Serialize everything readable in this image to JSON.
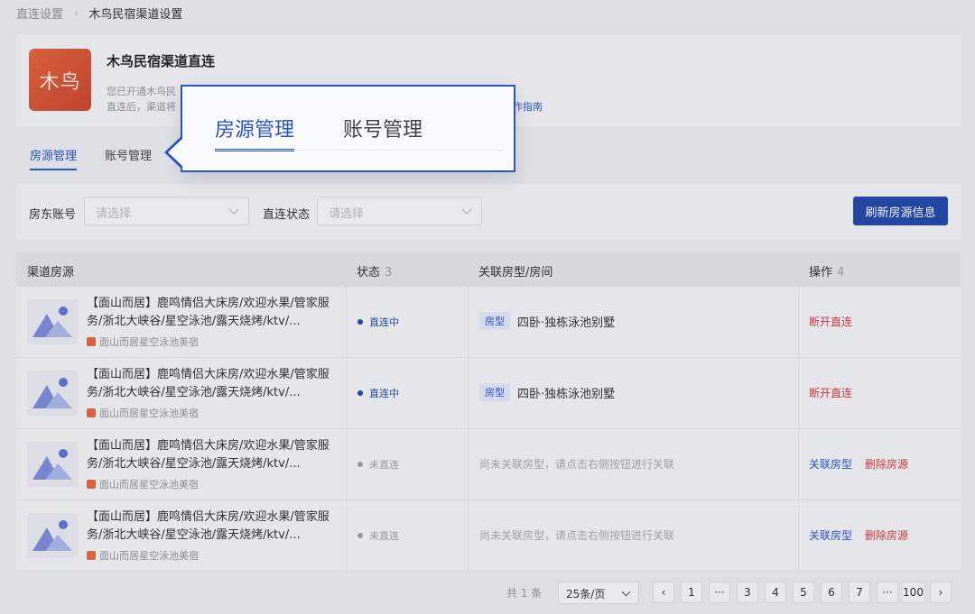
{
  "breadcrumb": {
    "parent": "直连设置",
    "current": "木鸟民宿渠道设置"
  },
  "channel": {
    "logo_text": "木鸟",
    "title": "木鸟民宿渠道直连",
    "desc_line1": "您已开通木鸟民",
    "desc_line2": "直连后，渠道将",
    "guide_link": "作指南"
  },
  "tabs": [
    {
      "label": "房源管理",
      "active": true
    },
    {
      "label": "账号管理",
      "active": false
    }
  ],
  "filters": {
    "landlord_label": "房东账号",
    "landlord_placeholder": "请选择",
    "status_label": "直连状态",
    "status_placeholder": "请选择",
    "refresh_button": "刷新房源信息"
  },
  "table": {
    "headers": [
      {
        "label": "渠道房源",
        "count": ""
      },
      {
        "label": "状态",
        "count": "3"
      },
      {
        "label": "关联房型/房间",
        "count": ""
      },
      {
        "label": "操作",
        "count": "4"
      }
    ],
    "rows": [
      {
        "title": "【面山而居】鹿鸣情侣大床房/欢迎水果/管家服务/浙北大峡谷/星空泳池/露天烧烤/ktv/...",
        "shop": "面山而居星空泳池美宿",
        "status": "直连中",
        "status_color": "#2347a8",
        "room_tag": "房型",
        "room_name": "四卧·独栋泳池别墅",
        "unlinked_text": "",
        "actions": [
          {
            "label": "断开直连",
            "tone": "red"
          }
        ]
      },
      {
        "title": "【面山而居】鹿鸣情侣大床房/欢迎水果/管家服务/浙北大峡谷/星空泳池/露天烧烤/ktv/...",
        "shop": "面山而居星空泳池美宿",
        "status": "直连中",
        "status_color": "#2347a8",
        "room_tag": "房型",
        "room_name": "四卧·独栋泳池别墅",
        "unlinked_text": "",
        "actions": [
          {
            "label": "断开直连",
            "tone": "red"
          }
        ]
      },
      {
        "title": "【面山而居】鹿鸣情侣大床房/欢迎水果/管家服务/浙北大峡谷/星空泳池/露天烧烤/ktv/...",
        "shop": "面山而居星空泳池美宿",
        "status": "未直连",
        "status_color": "#9a9ea6",
        "room_tag": "",
        "room_name": "",
        "unlinked_text": "尚未关联房型，请点击右侧按钮进行关联",
        "actions": [
          {
            "label": "关联房型",
            "tone": "blue"
          },
          {
            "label": "删除房源",
            "tone": "red"
          }
        ]
      },
      {
        "title": "【面山而居】鹿鸣情侣大床房/欢迎水果/管家服务/浙北大峡谷/星空泳池/露天烧烤/ktv/...",
        "shop": "面山而居星空泳池美宿",
        "status": "未直连",
        "status_color": "#9a9ea6",
        "room_tag": "",
        "room_name": "",
        "unlinked_text": "尚未关联房型，请点击右侧按钮进行关联",
        "actions": [
          {
            "label": "关联房型",
            "tone": "blue"
          },
          {
            "label": "删除房源",
            "tone": "red"
          }
        ]
      }
    ]
  },
  "pagination": {
    "total": "共 1 条",
    "page_size": "25条/页",
    "pages": [
      "‹",
      "1",
      "···",
      "3",
      "4",
      "5",
      "6",
      "7",
      "···",
      "100",
      "›"
    ]
  },
  "callout": {
    "tabs": [
      {
        "label": "房源管理",
        "active": true
      },
      {
        "label": "账号管理",
        "active": false
      }
    ]
  },
  "colors": {
    "accent": "#2a54c8",
    "danger": "#d33a3a",
    "logo": "#d9533a"
  }
}
